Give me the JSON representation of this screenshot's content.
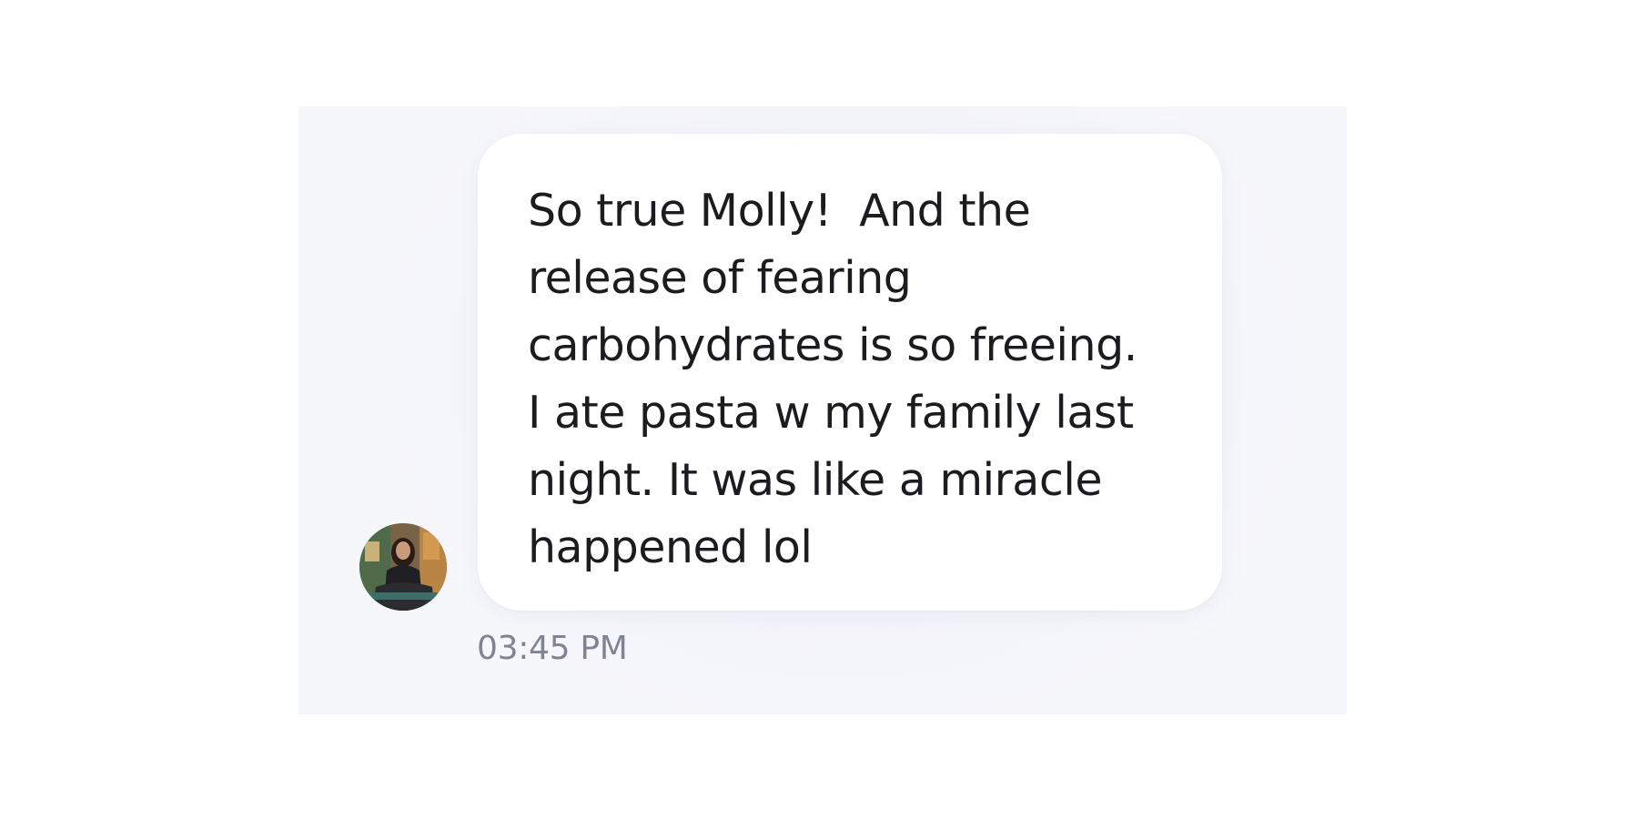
{
  "message": {
    "text": "So true Molly!  And the\nrelease of fearing\ncarbohydrates is so freeing.\nI ate pasta w my family last\nnight. It was like a miracle\nhappened lol",
    "timestamp": "03:45 PM",
    "sender_avatar": "user-photo-avatar"
  },
  "colors": {
    "page_background": "#ffffff",
    "panel_background": "#f6f7fb",
    "bubble_background": "#ffffff",
    "message_text": "#1c1c20",
    "timestamp_text": "#7f8394"
  }
}
